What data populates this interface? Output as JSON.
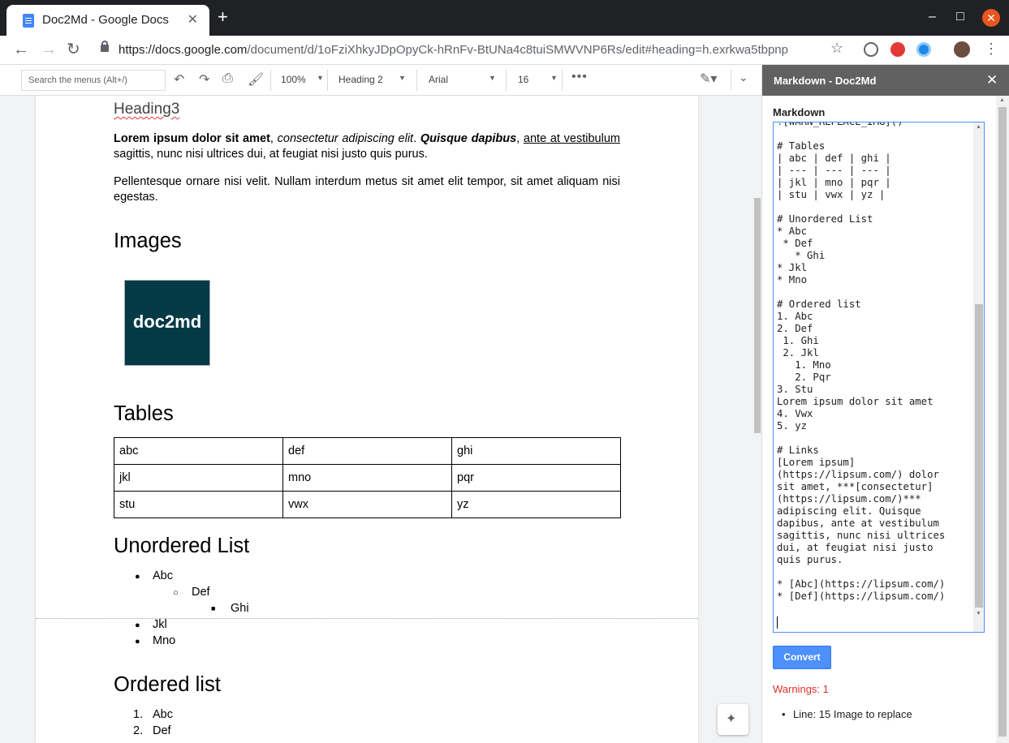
{
  "browser": {
    "tab_title": "Doc2Md - Google Docs",
    "tab_close": "✕",
    "new_tab": "+",
    "url_host": "https://docs.google.com",
    "url_path": "/document/d/1oFziXhkyJDpOpyCk-hRnFv-BtUNa4c8tuiSMWVNP6Rs/edit#heading=h.exrkwa5tbpnp",
    "window_min": "–",
    "window_max": "□",
    "window_close": "✕"
  },
  "toolbar": {
    "menu_search_placeholder": "Search the menus (Alt+/)",
    "zoom": "100%",
    "style": "Heading 2",
    "font": "Arial",
    "size": "16",
    "more": "•••"
  },
  "document": {
    "heading3": "Heading3",
    "p1": {
      "bold": "Lorem ipsum dolor sit amet",
      "sep1": ", ",
      "italic": "consectetur adipiscing elit",
      "sep2": ". ",
      "bolditalic": "Quisque dapibus",
      "sep3": ", ",
      "link": "ante at vestibulum",
      "rest": " sagittis, nunc nisi ultrices dui, at feugiat nisi justo quis purus."
    },
    "p2": "Pellentesque ornare nisi velit. Nullam interdum metus sit amet elit tempor, sit amet aliquam nisi egestas.",
    "images_heading": "Images",
    "logo_text": "doc2md",
    "tables_heading": "Tables",
    "table": [
      [
        "abc",
        "def",
        "ghi"
      ],
      [
        "jkl",
        "mno",
        "pqr"
      ],
      [
        "stu",
        "vwx",
        "yz"
      ]
    ],
    "unordered_heading": "Unordered List",
    "unordered": [
      {
        "text": "Abc",
        "bullet": "●"
      },
      {
        "text": "Def",
        "bullet": "○"
      },
      {
        "text": "Ghi",
        "bullet": "■"
      },
      {
        "text": "Jkl",
        "bullet": "●"
      },
      {
        "text": "Mno",
        "bullet": "●"
      }
    ],
    "ordered_heading": "Ordered list",
    "ordered": [
      {
        "num": "1.",
        "text": "Abc"
      },
      {
        "num": "2.",
        "text": "Def"
      }
    ]
  },
  "sidebar": {
    "title": "Markdown - Doc2Md",
    "close": "✕",
    "label": "Markdown",
    "markdown": "![WARN_REPLACE_IMG]()\n\n# Tables\n| abc | def | ghi |\n| --- | --- | --- |\n| jkl | mno | pqr |\n| stu | vwx | yz |\n\n# Unordered List\n* Abc\n * Def\n   * Ghi\n* Jkl\n* Mno\n\n# Ordered list\n1. Abc\n2. Def\n 1. Ghi\n 2. Jkl\n   1. Mno\n   2. Pqr\n3. Stu\nLorem ipsum dolor sit amet\n4. Vwx\n5. yz\n\n# Links\n[Lorem ipsum]\n(https://lipsum.com/) dolor\nsit amet, ***[consectetur]\n(https://lipsum.com/)***\nadipiscing elit. Quisque\ndapibus, ante at vestibulum\nsagittis, nunc nisi ultrices\ndui, at feugiat nisi justo\nquis purus.\n\n* [Abc](https://lipsum.com/)\n* [Def](https://lipsum.com/)",
    "convert_label": "Convert",
    "warnings": "Warnings: 1",
    "warning_items": [
      "Line: 15 Image to replace"
    ]
  }
}
